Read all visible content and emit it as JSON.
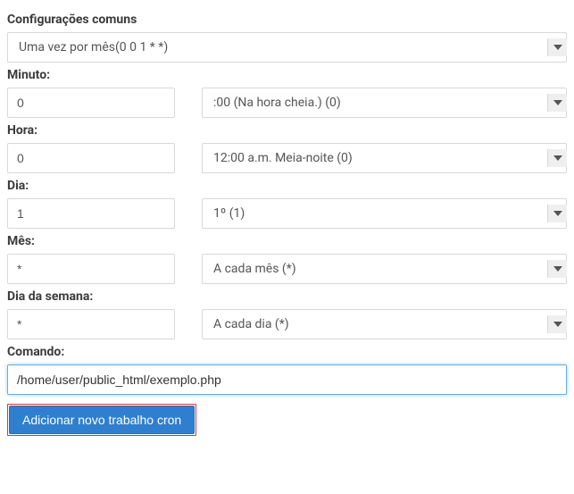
{
  "common": {
    "label": "Configurações comuns",
    "selected": "Uma vez por mês(0 0 1 * *)"
  },
  "minute": {
    "label": "Minuto:",
    "value": "0",
    "selected": ":00 (Na hora cheia.) (0)"
  },
  "hour": {
    "label": "Hora:",
    "value": "0",
    "selected": "12:00 a.m. Meia-noite (0)"
  },
  "day": {
    "label": "Dia:",
    "value": "1",
    "selected": "1º (1)"
  },
  "month": {
    "label": "Mês:",
    "value": "*",
    "selected": "A cada mês (*)"
  },
  "weekday": {
    "label": "Dia da semana:",
    "value": "*",
    "selected": "A cada dia (*)"
  },
  "command": {
    "label": "Comando:",
    "value": "/home/user/public_html/exemplo.php"
  },
  "submit": {
    "label": "Adicionar novo trabalho cron"
  }
}
